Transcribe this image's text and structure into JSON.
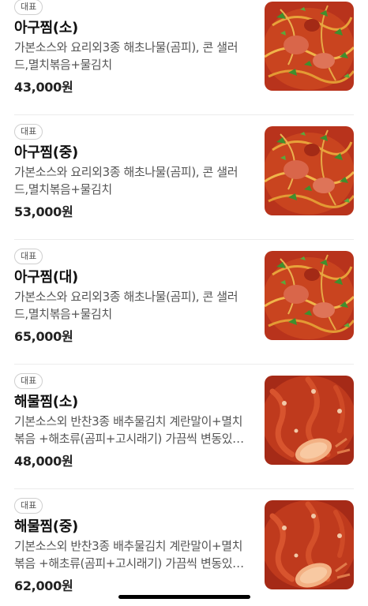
{
  "menu_items": [
    {
      "badge": "대표",
      "name": "아구찜(소)",
      "description": "가본소스와 요리외3종 해초나물(곰피), 콘 샐러드,멸치볶음+물김치",
      "price": "43,000원",
      "image": "braised-monkfish-photo"
    },
    {
      "badge": "대표",
      "name": "아구찜(중)",
      "description": "가본소스와 요리외3종 해초나물(곰피), 콘 샐러드,멸치볶음+물김치",
      "price": "53,000원",
      "image": "braised-monkfish-photo"
    },
    {
      "badge": "대표",
      "name": "아구찜(대)",
      "description": "가본소스와 요리외3종 해초나물(곰피), 콘 샐러드,멸치볶음+물김치",
      "price": "65,000원",
      "image": "braised-monkfish-photo"
    },
    {
      "badge": "대표",
      "name": "해물찜(소)",
      "description": "기본소스외 반찬3종 배추물김치 계란말이+멸치볶음 +해초류(곰피+고시래기) 가끔씩 변동있…",
      "price": "48,000원",
      "image": "braised-seafood-photo"
    },
    {
      "badge": "대표",
      "name": "해물찜(중)",
      "description": "기본소스외 반찬3종 배추물김치 계란말이+멸치볶음 +해초류(곰피+고시래기) 가끔씩 변동있…",
      "price": "62,000원",
      "image": "braised-seafood-photo"
    }
  ]
}
